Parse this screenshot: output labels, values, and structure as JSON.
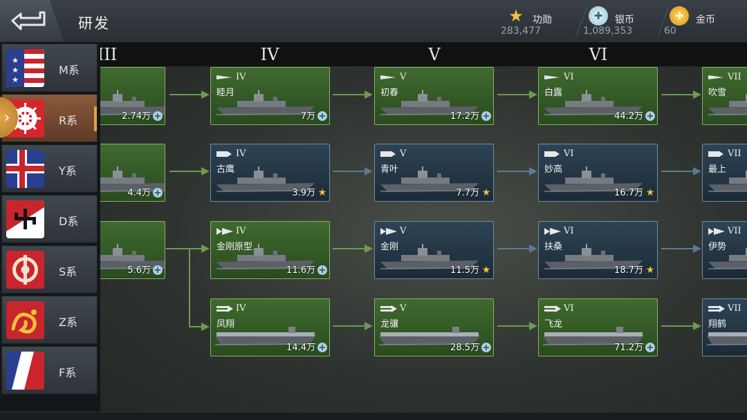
{
  "header": {
    "title": "研发",
    "resources": [
      {
        "name": "功勋",
        "value": "283,477",
        "icon": "merit-star-icon",
        "color": "#f2c23a"
      },
      {
        "name": "银币",
        "value": "1,089,353",
        "icon": "silver-coin-icon",
        "color": "#a9d6ea"
      },
      {
        "name": "金币",
        "value": "60",
        "icon": "gold-coin-icon",
        "color": "#f0b323"
      }
    ]
  },
  "tiers": [
    "III",
    "IV",
    "V",
    "VI"
  ],
  "nations": [
    {
      "label": "M系",
      "flag": "us-flag",
      "active": false
    },
    {
      "label": "R系",
      "flag": "japan-flag",
      "active": true
    },
    {
      "label": "Y系",
      "flag": "uk-flag",
      "active": false
    },
    {
      "label": "D系",
      "flag": "germany-flag",
      "active": false
    },
    {
      "label": "S系",
      "flag": "soviet-flag",
      "active": false
    },
    {
      "label": "Z系",
      "flag": "china-flag",
      "active": false
    },
    {
      "label": "F系",
      "flag": "france-flag",
      "active": false
    }
  ],
  "ships": {
    "row1": [
      {
        "tier": "",
        "name": "",
        "cost": "2.74万",
        "currency": "silver"
      },
      {
        "tier": "IV",
        "name": "睦月",
        "cost": "7万",
        "currency": "silver"
      },
      {
        "tier": "V",
        "name": "初春",
        "cost": "17.2万",
        "currency": "silver"
      },
      {
        "tier": "VI",
        "name": "白露",
        "cost": "44.2万",
        "currency": "silver"
      },
      {
        "tier": "VII",
        "name": "吹雪",
        "cost": "",
        "currency": ""
      }
    ],
    "row2": [
      {
        "tier": "",
        "name": "",
        "cost": "4.4万",
        "currency": "silver"
      },
      {
        "tier": "IV",
        "name": "古鹰",
        "cost": "3.9万",
        "currency": "merit"
      },
      {
        "tier": "V",
        "name": "青叶",
        "cost": "7.7万",
        "currency": "merit"
      },
      {
        "tier": "VI",
        "name": "妙高",
        "cost": "16.7万",
        "currency": "merit"
      },
      {
        "tier": "VII",
        "name": "最上",
        "cost": "",
        "currency": ""
      }
    ],
    "row3": [
      {
        "tier": "",
        "name": "",
        "cost": "5.6万",
        "currency": "silver"
      },
      {
        "tier": "IV",
        "name": "金刚原型",
        "cost": "11.6万",
        "currency": "silver"
      },
      {
        "tier": "V",
        "name": "金刚",
        "cost": "11.5万",
        "currency": "merit"
      },
      {
        "tier": "VI",
        "name": "扶桑",
        "cost": "18.7万",
        "currency": "merit"
      },
      {
        "tier": "VII",
        "name": "伊势",
        "cost": "",
        "currency": ""
      }
    ],
    "row4": [
      {
        "tier": "IV",
        "name": "凤翔",
        "cost": "14.4万",
        "currency": "silver"
      },
      {
        "tier": "V",
        "name": "龙骧",
        "cost": "28.5万",
        "currency": "silver"
      },
      {
        "tier": "VI",
        "name": "飞龙",
        "cost": "71.2万",
        "currency": "silver"
      },
      {
        "tier": "VII",
        "name": "翔鹤",
        "cost": "",
        "currency": ""
      }
    ]
  }
}
